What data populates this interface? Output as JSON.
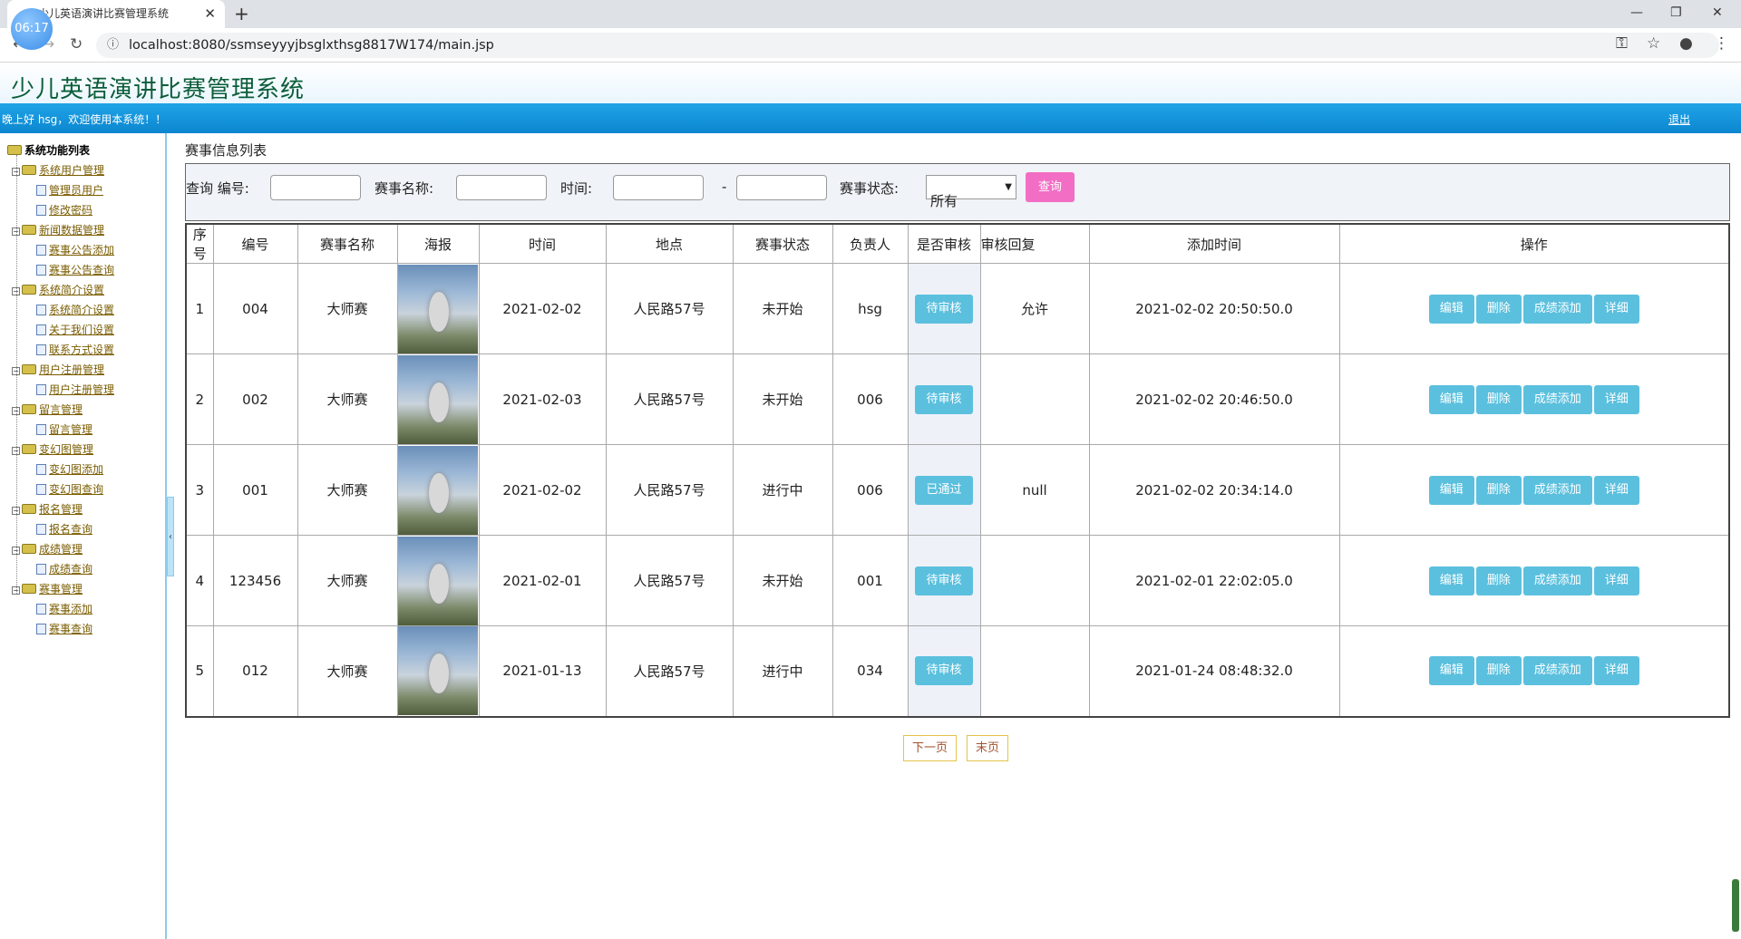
{
  "browser": {
    "clock": "06:17",
    "tab_title": "少儿英语演讲比赛管理系统",
    "url": "localhost:8080/ssmseyyyjbsglxthsg8817W174/main.jsp"
  },
  "header": {
    "title": "少儿英语演讲比赛管理系统",
    "greeting": "晚上好 hsg，欢迎使用本系统！！",
    "logout": "退出"
  },
  "sidebar": {
    "root": "系统功能列表",
    "groups": [
      {
        "label": "系统用户管理",
        "items": [
          "管理员用户",
          "修改密码"
        ]
      },
      {
        "label": "新闻数据管理",
        "items": [
          "赛事公告添加",
          "赛事公告查询"
        ]
      },
      {
        "label": "系统简介设置",
        "items": [
          "系统简介设置",
          "关于我们设置",
          "联系方式设置"
        ]
      },
      {
        "label": "用户注册管理",
        "items": [
          "用户注册管理"
        ]
      },
      {
        "label": "留言管理",
        "items": [
          "留言管理"
        ]
      },
      {
        "label": "变幻图管理",
        "items": [
          "变幻图添加",
          "变幻图查询"
        ]
      },
      {
        "label": "报名管理",
        "items": [
          "报名查询"
        ]
      },
      {
        "label": "成绩管理",
        "items": [
          "成绩查询"
        ]
      },
      {
        "label": "赛事管理",
        "items": [
          "赛事添加",
          "赛事查询"
        ]
      }
    ]
  },
  "main": {
    "list_title": "赛事信息列表",
    "search": {
      "query_label": "查询 编号:",
      "name_label": "赛事名称:",
      "time_label": "时间:",
      "dash": "-",
      "status_label": "赛事状态:",
      "status_value": "所有",
      "button": "查询"
    },
    "columns": [
      "序号",
      "编号",
      "赛事名称",
      "海报",
      "时间",
      "地点",
      "赛事状态",
      "负责人",
      "是否审核",
      "审核回复",
      "添加时间",
      "操作"
    ],
    "rows": [
      {
        "seq": "1",
        "code": "004",
        "name": "大师赛",
        "time": "2021-02-02",
        "place": "人民路57号",
        "status": "未开始",
        "owner": "hsg",
        "audit": "待审核",
        "reply": "允许",
        "added": "2021-02-02 20:50:50.0"
      },
      {
        "seq": "2",
        "code": "002",
        "name": "大师赛",
        "time": "2021-02-03",
        "place": "人民路57号",
        "status": "未开始",
        "owner": "006",
        "audit": "待审核",
        "reply": "",
        "added": "2021-02-02 20:46:50.0"
      },
      {
        "seq": "3",
        "code": "001",
        "name": "大师赛",
        "time": "2021-02-02",
        "place": "人民路57号",
        "status": "进行中",
        "owner": "006",
        "audit": "已通过",
        "reply": "null",
        "added": "2021-02-02 20:34:14.0"
      },
      {
        "seq": "4",
        "code": "123456",
        "name": "大师赛",
        "time": "2021-02-01",
        "place": "人民路57号",
        "status": "未开始",
        "owner": "001",
        "audit": "待审核",
        "reply": "",
        "added": "2021-02-01 22:02:05.0"
      },
      {
        "seq": "5",
        "code": "012",
        "name": "大师赛",
        "time": "2021-01-13",
        "place": "人民路57号",
        "status": "进行中",
        "owner": "034",
        "audit": "待审核",
        "reply": "",
        "added": "2021-01-24 08:48:32.0"
      }
    ],
    "ops": [
      "编辑",
      "删除",
      "成绩添加",
      "详细"
    ],
    "pager": {
      "next": "下一页",
      "last": "末页"
    }
  },
  "colors": {
    "accent_blue": "#0b86cf",
    "query_button": "#f26ec4",
    "action_button": "#5bc0de"
  }
}
